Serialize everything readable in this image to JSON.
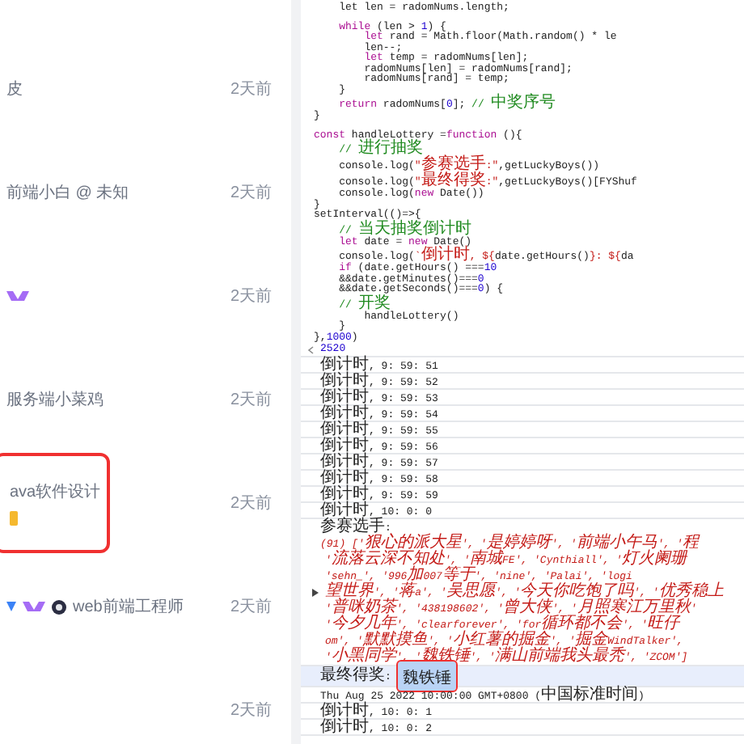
{
  "feed": {
    "items": [
      {
        "text": "皮",
        "time": "2天前",
        "highlighted": false
      },
      {
        "text": "前端小白 @ 未知",
        "time": "2天前",
        "highlighted": false
      },
      {
        "badges": [
          {
            "kind": "level"
          }
        ],
        "time": "2天前",
        "highlighted": false
      },
      {
        "text": "服务端小菜鸡",
        "time": "2天前",
        "highlighted": false
      },
      {
        "text": "ava软件设计",
        "badges": [
          {
            "kind": "medal"
          }
        ],
        "time": "2天前",
        "highlighted": true
      },
      {
        "badges": [
          {
            "kind": "vip"
          },
          {
            "kind": "level"
          },
          {
            "kind": "round"
          }
        ],
        "text": "web前端工程师",
        "time": "2天前",
        "highlighted": false
      },
      {
        "time": "2天前",
        "highlighted": false
      }
    ]
  },
  "code": {
    "lines": [
      {
        "tokens": [
          {
            "kind": "plain",
            "t": "    let len = radomNums.length;"
          }
        ]
      },
      {
        "blank_before": true,
        "tokens": [
          {
            "kind": "kw",
            "t": "    while"
          },
          {
            "kind": "plain",
            "t": " (len > "
          },
          {
            "kind": "num",
            "t": "1"
          },
          {
            "kind": "plain",
            "t": ") {"
          }
        ]
      },
      {
        "tokens": [
          {
            "kind": "kw",
            "t": "        let"
          },
          {
            "kind": "plain",
            "t": " rand = Math.floor(Math.random() * le"
          }
        ]
      },
      {
        "tokens": [
          {
            "kind": "plain",
            "t": "        len--;"
          }
        ]
      },
      {
        "tokens": [
          {
            "kind": "kw",
            "t": "        let"
          },
          {
            "kind": "plain",
            "t": " temp = radomNums[len];"
          }
        ]
      },
      {
        "tokens": [
          {
            "kind": "plain",
            "t": "        radomNums[len] = radomNums[rand];"
          }
        ]
      },
      {
        "tokens": [
          {
            "kind": "plain",
            "t": "        radomNums[rand] = temp;"
          }
        ]
      },
      {
        "tokens": [
          {
            "kind": "plain",
            "t": "    }"
          }
        ]
      },
      {
        "tokens": [
          {
            "kind": "kw",
            "t": "    return"
          },
          {
            "kind": "plain",
            "t": " radomNums["
          },
          {
            "kind": "num",
            "t": "0"
          },
          {
            "kind": "plain",
            "t": "]; "
          },
          {
            "kind": "com",
            "t": "// 中奖序号"
          }
        ]
      },
      {
        "tokens": [
          {
            "kind": "plain",
            "t": "}"
          }
        ]
      },
      {
        "blank_before": true,
        "tokens": [
          {
            "kind": "kw",
            "t": "const"
          },
          {
            "kind": "plain",
            "t": " handleLottery ="
          },
          {
            "kind": "kw",
            "t": "function"
          },
          {
            "kind": "plain",
            "t": " (){"
          }
        ]
      },
      {
        "tokens": [
          {
            "kind": "com",
            "t": "    // 进行抽奖"
          }
        ]
      },
      {
        "tokens": [
          {
            "kind": "plain",
            "t": "    console.log("
          },
          {
            "kind": "str",
            "t": "\"参赛选手:\""
          },
          {
            "kind": "plain",
            "t": ",getLuckyBoys())"
          }
        ]
      },
      {
        "tokens": [
          {
            "kind": "plain",
            "t": "    console.log("
          },
          {
            "kind": "str",
            "t": "\"最终得奖:\""
          },
          {
            "kind": "plain",
            "t": ",getLuckyBoys()[FYShuf"
          }
        ]
      },
      {
        "tokens": [
          {
            "kind": "plain",
            "t": "    console.log("
          },
          {
            "kind": "kw",
            "t": "new"
          },
          {
            "kind": "plain",
            "t": " Date())"
          }
        ]
      },
      {
        "tokens": [
          {
            "kind": "plain",
            "t": "}"
          }
        ]
      },
      {
        "tokens": [
          {
            "kind": "plain",
            "t": "setInterval(()=>{"
          }
        ]
      },
      {
        "tokens": [
          {
            "kind": "com",
            "t": "    // 当天抽奖倒计时"
          }
        ]
      },
      {
        "tokens": [
          {
            "kind": "kw",
            "t": "    let"
          },
          {
            "kind": "plain",
            "t": " date = "
          },
          {
            "kind": "kw",
            "t": "new"
          },
          {
            "kind": "plain",
            "t": " Date()"
          }
        ]
      },
      {
        "tokens": [
          {
            "kind": "plain",
            "t": "    console.log("
          },
          {
            "kind": "str",
            "t": "`倒计时, ${"
          },
          {
            "kind": "plain",
            "t": "date.getHours()"
          },
          {
            "kind": "str",
            "t": "}: ${"
          },
          {
            "kind": "plain",
            "t": "da"
          }
        ]
      },
      {
        "tokens": [
          {
            "kind": "kw",
            "t": "    if"
          },
          {
            "kind": "plain",
            "t": " (date.getHours() ==="
          },
          {
            "kind": "num",
            "t": "10"
          }
        ]
      },
      {
        "tokens": [
          {
            "kind": "plain",
            "t": "    &&date.getMinutes()==="
          },
          {
            "kind": "num",
            "t": "0"
          }
        ]
      },
      {
        "tokens": [
          {
            "kind": "plain",
            "t": "    &&date.getSeconds()==="
          },
          {
            "kind": "num",
            "t": "0"
          },
          {
            "kind": "plain",
            "t": ") {"
          }
        ]
      },
      {
        "tokens": [
          {
            "kind": "com",
            "t": "    // 开奖"
          }
        ]
      },
      {
        "tokens": [
          {
            "kind": "plain",
            "t": "        handleLottery()"
          }
        ]
      },
      {
        "tokens": [
          {
            "kind": "plain",
            "t": "    }"
          }
        ]
      },
      {
        "tokens": [
          {
            "kind": "plain",
            "t": "},"
          },
          {
            "kind": "num",
            "t": "1000"
          },
          {
            "kind": "plain",
            "t": ")"
          }
        ]
      }
    ]
  },
  "console": {
    "result": "2520",
    "entries": [
      {
        "kind": "log",
        "text": "倒计时, 9: 59: 51"
      },
      {
        "kind": "log",
        "text": "倒计时, 9: 59: 52"
      },
      {
        "kind": "log",
        "text": "倒计时, 9: 59: 53"
      },
      {
        "kind": "log",
        "text": "倒计时, 9: 59: 54"
      },
      {
        "kind": "log",
        "text": "倒计时, 9: 59: 55"
      },
      {
        "kind": "log",
        "text": "倒计时, 9: 59: 56"
      },
      {
        "kind": "log",
        "text": "倒计时, 9: 59: 57"
      },
      {
        "kind": "log",
        "text": "倒计时, 9: 59: 58"
      },
      {
        "kind": "log",
        "text": "倒计时, 9: 59: 59"
      },
      {
        "kind": "log",
        "text": "倒计时, 10: 0: 0"
      },
      {
        "kind": "array",
        "label": "参赛选手:",
        "expanded": false,
        "lines": [
          "(91) ['狠心的派大星', '是婷婷呀', '前端小午马', '程",
          "'流落云深不知处', '南城FE', 'Cynthiall', '灯火阑珊",
          "'sehn_', '996加007等于', 'nine', 'Palai', 'logi",
          "望世界', '蒋a', '吴思愿', '今天你吃饱了吗', '优秀稳上",
          "'普咪奶茶', '438198602', '曾大侠', '月照寒江万里秋'",
          "'今夕几年', 'clearforever', 'for循环都不会', '旺仔",
          "om', '默默摸鱼', '小红薯的掘金', '掘金WindTalker',",
          "'小黑同学', '魏铁锤', '满山前端我头最秃', 'ZCOM']"
        ]
      },
      {
        "kind": "pair",
        "label": "最终得奖:",
        "value": "魏铁锤",
        "selected": true,
        "highlighted": true
      },
      {
        "kind": "log",
        "text": "Thu Aug 25 2022 10:00:00 GMT+0800 (中国标准时间)"
      },
      {
        "kind": "log",
        "text": "倒计时, 10: 0: 1"
      },
      {
        "kind": "log",
        "text": "倒计时, 10: 0: 2"
      }
    ]
  }
}
